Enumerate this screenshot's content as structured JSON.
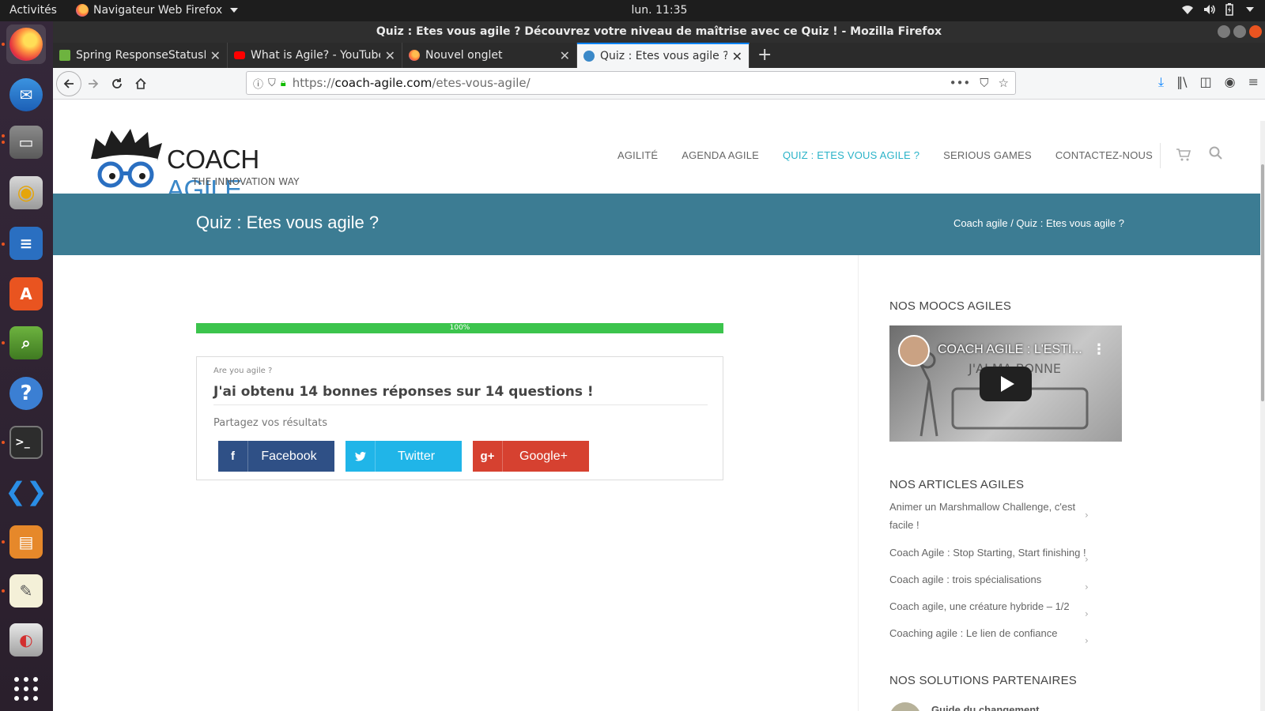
{
  "topbar": {
    "activities": "Activités",
    "app_name": "Navigateur Web Firefox",
    "clock": "lun. 11:35"
  },
  "dock": {
    "items": [
      "firefox-icon",
      "thunderbird-icon",
      "files-icon",
      "rhythmbox-icon",
      "writer-icon",
      "software-icon",
      "image-viewer-icon",
      "help-icon",
      "terminal-icon",
      "vscode-icon",
      "impress-icon",
      "text-editor-icon",
      "screenshot-icon",
      "apps-grid-icon"
    ]
  },
  "window": {
    "title": "Quiz : Etes vous agile ? Découvrez votre niveau de maîtrise avec ce Quiz ! - Mozilla Firefox"
  },
  "tabs": [
    {
      "label": "Spring ResponseStatusE",
      "color": "#6db33f"
    },
    {
      "label": "What is Agile? - YouTube",
      "color": "#ff0000"
    },
    {
      "label": "Nouvel onglet",
      "color": "#ff7139"
    },
    {
      "label": "Quiz : Etes vous agile ? De",
      "color": "#3a88c8"
    }
  ],
  "url": {
    "prefix": "https://",
    "host": "coach-agile.com",
    "path": "/etes-vous-agile/"
  },
  "site": {
    "brand_part1": "COACH",
    "brand_part2": " AGILE",
    "tagline": "THE INNOVATION WAY",
    "nav": [
      "AGILITÉ",
      "AGENDA AGILE",
      "QUIZ : ETES VOUS AGILE ?",
      "SERIOUS GAMES",
      "CONTACTEZ-NOUS"
    ],
    "page_title": "Quiz : Etes vous agile ?",
    "breadcrumb": "Coach agile / Quiz : Etes vous agile ?"
  },
  "quiz": {
    "progress_label": "100%",
    "progress": 1.0,
    "quiz_name": "Are you agile ?",
    "result": "J'ai obtenu 14 bonnes réponses sur 14 questions !",
    "share_label": "Partagez vos résultats",
    "buttons": {
      "facebook": "Facebook",
      "twitter": "Twitter",
      "google": "Google+"
    }
  },
  "sidebar": {
    "moocs_heading": "NOS MOOCS AGILES",
    "video_title": "COACH AGILE : L'ESTI...",
    "articles_heading": "NOS ARTICLES AGILES",
    "articles": [
      "Animer un Marshmallow Challenge, c'est facile !",
      "Coach Agile : Stop Starting, Start finishing !",
      "Coach agile : trois spécialisations",
      "Coach agile, une créature hybride – 1/2",
      "Coaching agile : Le lien de confiance"
    ],
    "partners_heading": "NOS SOLUTIONS PARTENAIRES",
    "partner_title": "Guide du changement"
  },
  "colors": {
    "banner": "#3c7c93",
    "progress": "#3cc44d",
    "facebook": "#2f5086",
    "twitter": "#20b5e8",
    "google": "#d64130",
    "nav_active": "#2ab3c8"
  }
}
